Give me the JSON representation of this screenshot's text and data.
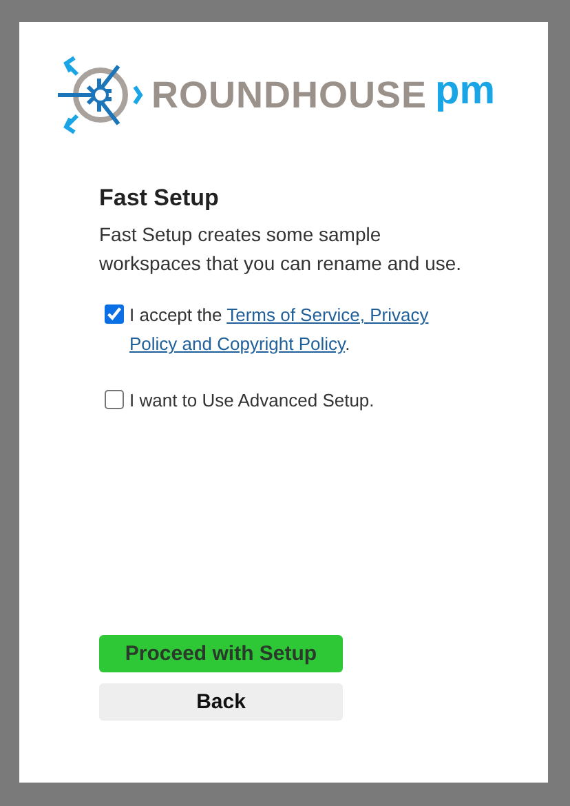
{
  "logo": {
    "name": "ROUNDHOUSE",
    "suffix": "pm"
  },
  "heading": "Fast Setup",
  "description": "Fast Setup creates some sample workspaces that you can rename and use.",
  "options": [
    {
      "kind": "terms",
      "checked": true,
      "text": "I accept the ",
      "links": [
        "Terms of Service, Privacy",
        "Policy and Copyright Policy"
      ],
      "after": "."
    },
    {
      "kind": "plain",
      "checked": false,
      "text": "I want to Use Advanced Setup."
    }
  ],
  "buttons": [
    {
      "kind": "primary",
      "label": "Proceed with Setup"
    },
    {
      "kind": "secondary",
      "label": "Back"
    }
  ]
}
